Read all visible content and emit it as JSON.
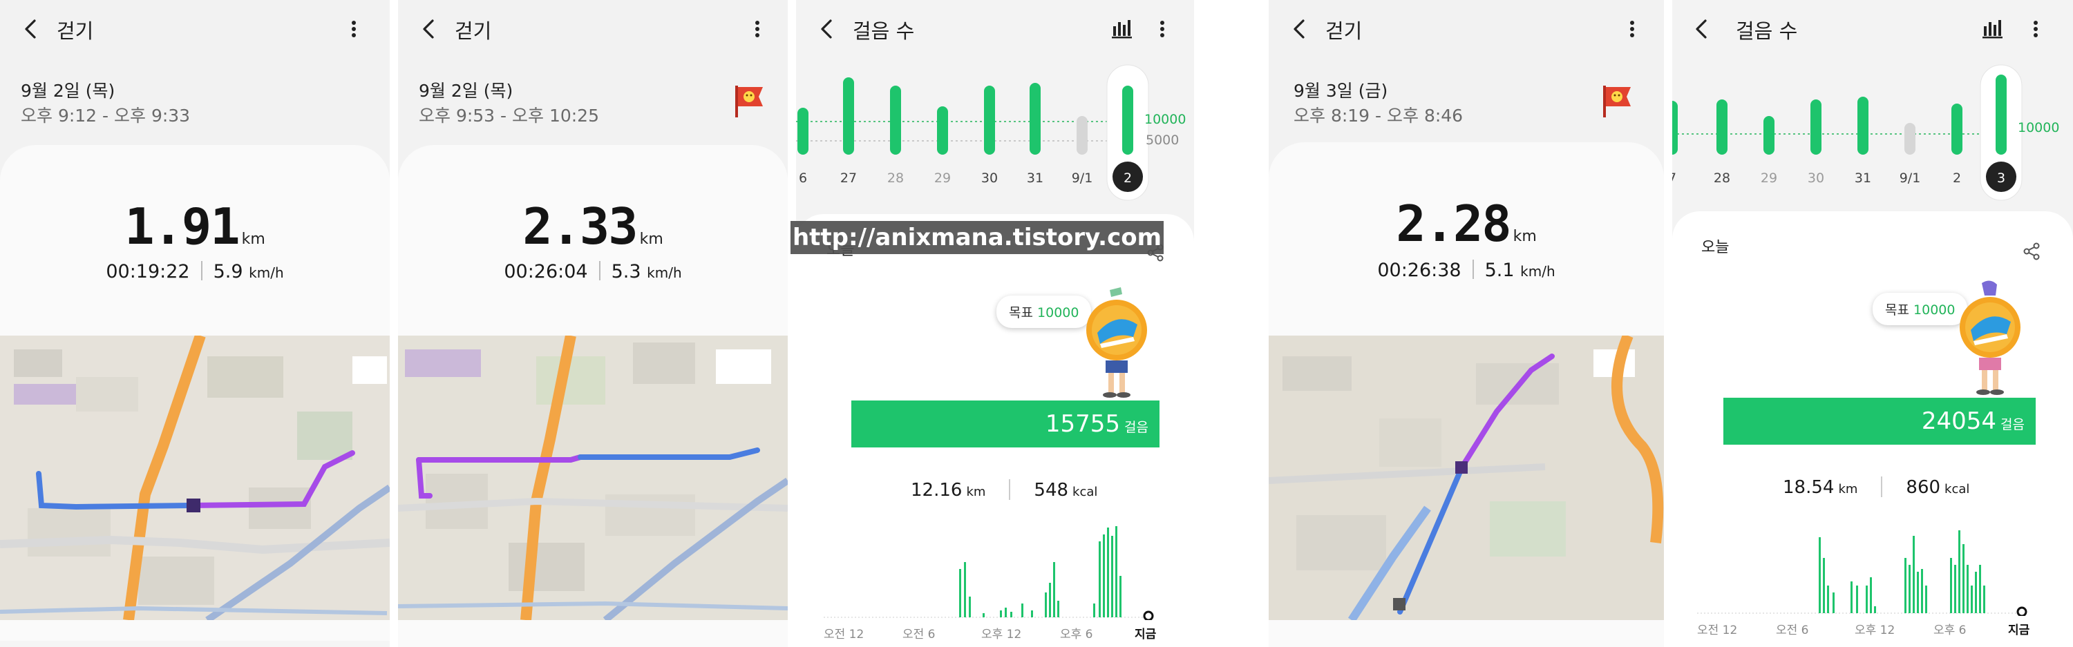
{
  "walk1": {
    "title": "걷기",
    "date": "9월 2일 (목)",
    "time_range": "오후 9:12 - 오후 9:33",
    "distance": "1.91",
    "distance_unit": "km",
    "duration": "00:19:22",
    "speed": "5.9",
    "speed_unit": "km/h"
  },
  "walk2": {
    "title": "걷기",
    "date": "9월 2일 (목)",
    "time_range": "오후 9:53 - 오후 10:25",
    "distance": "2.33",
    "distance_unit": "km",
    "duration": "00:26:04",
    "speed": "5.3",
    "speed_unit": "km/h"
  },
  "steps1": {
    "title": "걸음 수",
    "week_labels": [
      "6",
      "27",
      "28",
      "29",
      "30",
      "31",
      "9/1",
      "2"
    ],
    "goal_line_label": "10000",
    "secondary_line_label": "5000",
    "today_label": "오늘",
    "goal_prefix": "목표",
    "goal_value": "10000",
    "steps": "15755",
    "steps_unit": "걸음",
    "distance": "12.16",
    "distance_unit": "km",
    "kcal": "548",
    "kcal_unit": "kcal",
    "hour_labels": [
      "오전 12",
      "오전 6",
      "오후 12",
      "오후 6",
      "지금"
    ]
  },
  "walk3": {
    "title": "걷기",
    "date": "9월 3일 (금)",
    "time_range": "오후 8:19 - 오후 8:46",
    "distance": "2.28",
    "distance_unit": "km",
    "duration": "00:26:38",
    "speed": "5.1",
    "speed_unit": "km/h"
  },
  "steps2": {
    "title": "걸음 수",
    "week_labels": [
      "7",
      "28",
      "29",
      "30",
      "31",
      "9/1",
      "2",
      "3"
    ],
    "goal_line_label": "10000",
    "today_label": "오늘",
    "goal_prefix": "목표",
    "goal_value": "10000",
    "steps": "24054",
    "steps_unit": "걸음",
    "distance": "18.54",
    "distance_unit": "km",
    "kcal": "860",
    "kcal_unit": "kcal",
    "hour_labels": [
      "오전 12",
      "오전 6",
      "오후 12",
      "오후 6",
      "지금"
    ]
  },
  "watermark": "http://anixmana.tistory.com",
  "colors": {
    "accent_green": "#1ec46c",
    "goal_line": "#22b45a",
    "route_blue": "#4a7de0",
    "route_purple": "#a64be8",
    "inactive_bar": "#d6d6d6",
    "selected_day": "#222222"
  },
  "icons": [
    "back-arrow-icon",
    "more-vertical-icon",
    "bar-chart-icon",
    "flag-icon",
    "share-icon"
  ]
}
